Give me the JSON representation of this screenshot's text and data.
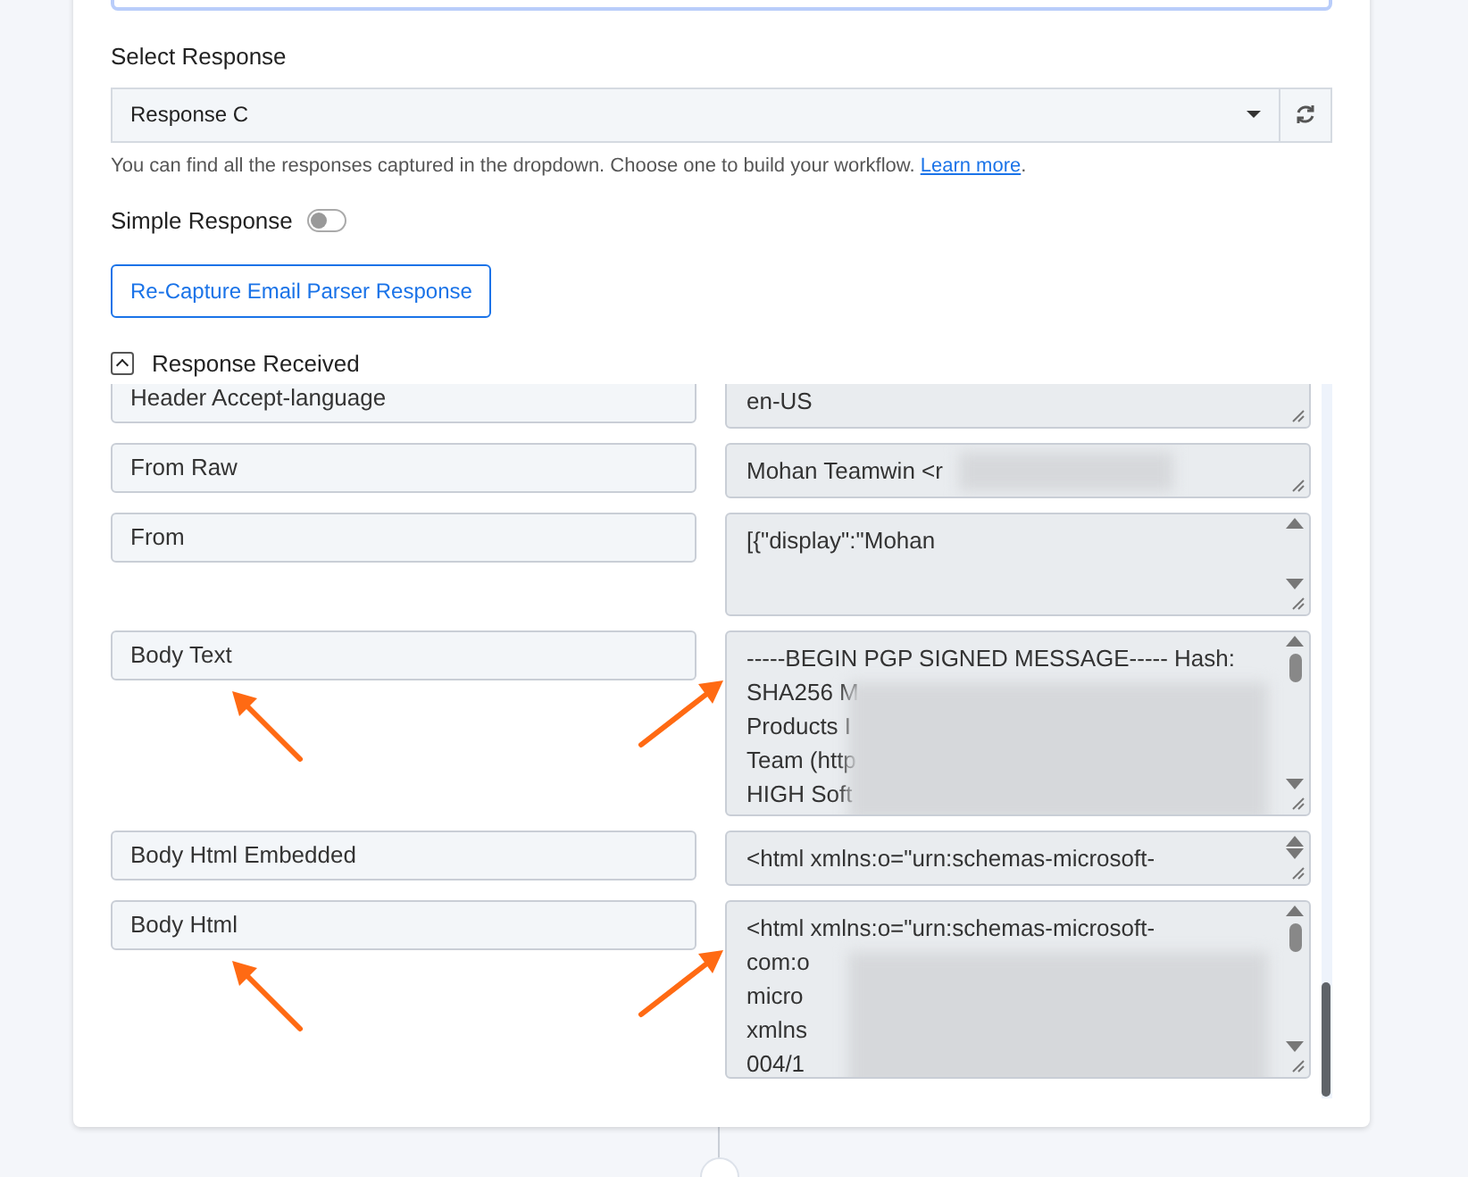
{
  "select_response": {
    "label": "Select Response",
    "value": "Response C",
    "help": "You can find all the responses captured in the dropdown. Choose one to build your workflow.",
    "help_link": "Learn more",
    "help_end": "."
  },
  "simple_response": {
    "label": "Simple Response",
    "on": false
  },
  "recapture_button": "Re-Capture Email Parser Response",
  "response_received": {
    "label": "Response Received",
    "expanded": true
  },
  "rows": [
    {
      "label": "Header Accept-language",
      "lines": [
        "en-US"
      ],
      "kind": "short",
      "scrollable": false,
      "blurred": false,
      "arrow": false
    },
    {
      "label": "From Raw",
      "lines": [
        "Mohan Teamwin <r"
      ],
      "kind": "short",
      "scrollable": false,
      "blurred": true,
      "arrow": false
    },
    {
      "label": "From",
      "lines": [
        "[{\"display\":\"Mohan"
      ],
      "kind": "medium",
      "scrollable": true,
      "blurred": false,
      "arrow": false
    },
    {
      "label": "Body Text",
      "lines": [
        "-----BEGIN PGP SIGNED MESSAGE----- Hash:",
        "SHA256 M",
        "Products I",
        "Team (http",
        "HIGH Soft"
      ],
      "kind": "tall",
      "scrollable": true,
      "blurred": true,
      "arrow": true
    },
    {
      "label": "Body Html Embedded",
      "lines": [
        "<html xmlns:o=\"urn:schemas-microsoft-"
      ],
      "kind": "short",
      "scrollable": true,
      "blurred": false,
      "arrow": false
    },
    {
      "label": "Body Html",
      "lines": [
        "<html xmlns:o=\"urn:schemas-microsoft-",
        "com:o",
        "micro",
        "xmlns",
        "004/1"
      ],
      "kind": "taller",
      "scrollable": true,
      "blurred": true,
      "arrow": true
    }
  ]
}
